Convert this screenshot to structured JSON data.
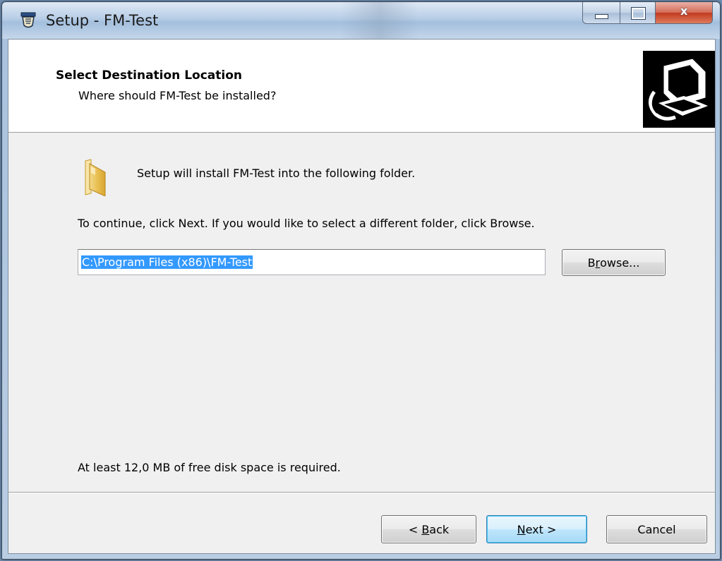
{
  "window": {
    "title": "Setup - FM-Test",
    "close_glyph": "x"
  },
  "header": {
    "title": "Select Destination Location",
    "subtitle": "Where should FM-Test be installed?"
  },
  "body": {
    "install_line": "Setup will install FM-Test into the following folder.",
    "continue_line": "To continue, click Next. If you would like to select a different folder, click Browse.",
    "path_value": "C:\\Program Files (x86)\\FM-Test",
    "disk_space_line": "At least 12,0 MB of free disk space is required."
  },
  "buttons": {
    "browse": {
      "pre": "B",
      "accel": "r",
      "post": "owse..."
    },
    "back": {
      "pre": "< ",
      "accel": "B",
      "post": "ack"
    },
    "next": {
      "pre": "",
      "accel": "N",
      "post": "ext >"
    },
    "cancel": "Cancel"
  },
  "colors": {
    "selection": "#3399ff",
    "close_red": "#c0391f",
    "dialog_bg": "#f0f0f0"
  },
  "icons": [
    "setup-app-icon",
    "minimize-icon",
    "maximize-icon",
    "close-icon",
    "computer-install-icon",
    "folder-icon"
  ]
}
